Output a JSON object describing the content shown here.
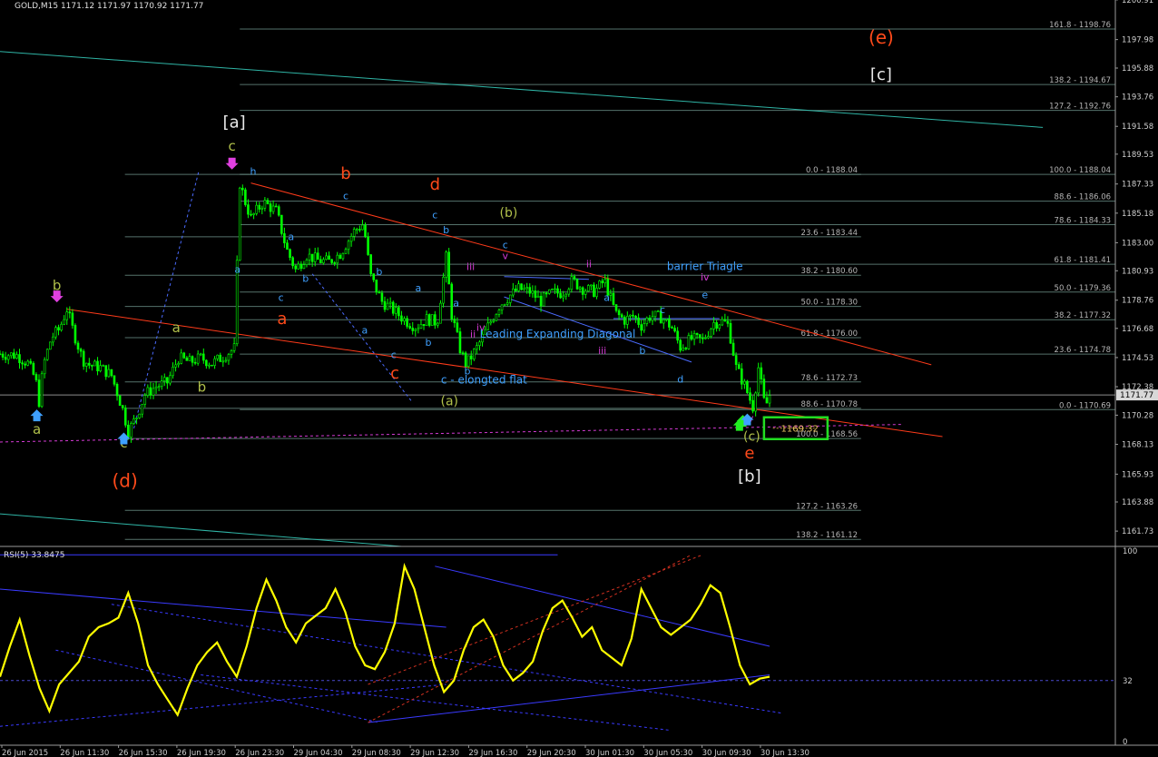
{
  "symbol_header": "GOLD,M15  1171.12 1171.97 1170.92 1171.77",
  "rsi_header": "RSI(5) 33.8475",
  "current_price_tag": "1171.77",
  "target_box_text": "1169.32",
  "colors": {
    "background": "#000000",
    "candle": "#00ff00",
    "level_line": "#6b8f86",
    "fib_text": "#b5b5b5",
    "trend_red": "#ff3b1a",
    "channel_teal": "#2fb4a5",
    "rsi_line": "#ffff00",
    "rsi_guides": "#3a3aff",
    "dotted_magenta": "#d43ad4",
    "target_box": "#22dd22"
  },
  "chart_data": {
    "type": "candlestick",
    "price_axis": {
      "range": [
        1160.6,
        1200.9
      ],
      "ticks": [
        "1200.91",
        "1197.98",
        "1195.88",
        "1193.76",
        "1191.58",
        "1189.53",
        "1187.33",
        "1185.18",
        "1183.00",
        "1180.93",
        "1178.76",
        "1176.68",
        "1174.53",
        "1172.38",
        "1170.28",
        "1168.13",
        "1165.93",
        "1163.88",
        "1161.73"
      ]
    },
    "time_axis": {
      "range": [
        0,
        100
      ],
      "labels": [
        "26 Jun 2015",
        "26 Jun 11:30",
        "26 Jun 15:30",
        "26 Jun 19:30",
        "26 Jun 23:30",
        "29 Jun 04:30",
        "29 Jun 08:30",
        "29 Jun 12:30",
        "29 Jun 16:30",
        "29 Jun 20:30",
        "30 Jun 01:30",
        "30 Jun 05:30",
        "30 Jun 09:30",
        "30 Jun 13:30"
      ]
    },
    "price_path": [
      [
        0.0,
        1174.8
      ],
      [
        1.5,
        1174.7
      ],
      [
        2.5,
        1174.1
      ],
      [
        3.2,
        1172.9
      ],
      [
        3.5,
        1171.3
      ],
      [
        3.9,
        1174.0
      ],
      [
        4.6,
        1176.0
      ],
      [
        5.3,
        1176.6
      ],
      [
        6.0,
        1178.1
      ],
      [
        6.6,
        1176.4
      ],
      [
        7.4,
        1174.4
      ],
      [
        8.0,
        1174.0
      ],
      [
        9.0,
        1173.8
      ],
      [
        10.0,
        1173.2
      ],
      [
        11.0,
        1170.7
      ],
      [
        11.5,
        1169.1
      ],
      [
        12.2,
        1170.1
      ],
      [
        13.0,
        1171.8
      ],
      [
        14.0,
        1172.4
      ],
      [
        15.0,
        1172.7
      ],
      [
        16.0,
        1174.5
      ],
      [
        17.0,
        1174.2
      ],
      [
        18.0,
        1174.5
      ],
      [
        19.0,
        1174.1
      ],
      [
        20.0,
        1174.6
      ],
      [
        21.0,
        1175.2
      ],
      [
        21.5,
        1187.4
      ],
      [
        22.0,
        1186.0
      ],
      [
        22.5,
        1184.8
      ],
      [
        23.6,
        1186.0
      ],
      [
        24.8,
        1185.3
      ],
      [
        25.7,
        1182.5
      ],
      [
        26.5,
        1181.0
      ],
      [
        27.5,
        1182.1
      ],
      [
        28.5,
        1181.7
      ],
      [
        29.5,
        1181.6
      ],
      [
        30.5,
        1182.2
      ],
      [
        31.8,
        1183.9
      ],
      [
        32.6,
        1184.4
      ],
      [
        33.2,
        1180.6
      ],
      [
        34.2,
        1178.7
      ],
      [
        35.3,
        1178.0
      ],
      [
        36.3,
        1177.3
      ],
      [
        37.3,
        1176.8
      ],
      [
        38.3,
        1177.4
      ],
      [
        39.2,
        1177.1
      ],
      [
        40.0,
        1181.9
      ],
      [
        40.5,
        1177.7
      ],
      [
        41.3,
        1175.0
      ],
      [
        41.8,
        1174.0
      ],
      [
        42.8,
        1175.3
      ],
      [
        43.8,
        1176.9
      ],
      [
        44.8,
        1178.4
      ],
      [
        45.7,
        1179.1
      ],
      [
        46.5,
        1179.6
      ],
      [
        47.5,
        1179.4
      ],
      [
        48.5,
        1178.7
      ],
      [
        49.5,
        1179.3
      ],
      [
        50.4,
        1179.3
      ],
      [
        51.3,
        1180.2
      ],
      [
        52.3,
        1179.6
      ],
      [
        53.3,
        1179.4
      ],
      [
        54.2,
        1180.2
      ],
      [
        55.2,
        1177.8
      ],
      [
        56.0,
        1177.3
      ],
      [
        56.8,
        1177.6
      ],
      [
        57.5,
        1176.9
      ],
      [
        58.3,
        1177.6
      ],
      [
        59.3,
        1177.5
      ],
      [
        60.2,
        1176.8
      ],
      [
        61.0,
        1175.3
      ],
      [
        62.0,
        1175.9
      ],
      [
        63.0,
        1175.8
      ],
      [
        64.0,
        1177.1
      ],
      [
        64.8,
        1177.2
      ],
      [
        65.3,
        1176.9
      ],
      [
        66.0,
        1173.8
      ],
      [
        66.8,
        1172.4
      ],
      [
        67.5,
        1170.9
      ],
      [
        68.0,
        1173.8
      ],
      [
        68.6,
        1170.8
      ],
      [
        69.0,
        1171.77
      ]
    ],
    "fib_levels_left": [
      {
        "label": "0.0 - 1188.04",
        "price": 1188.04
      },
      {
        "label": "23.6 - 1183.44",
        "price": 1183.44
      },
      {
        "label": "38.2 - 1180.60",
        "price": 1180.6
      },
      {
        "label": "50.0 - 1178.30",
        "price": 1178.3
      },
      {
        "label": "61.8 - 1176.00",
        "price": 1176.0
      },
      {
        "label": "78.6 - 1172.73",
        "price": 1172.73
      },
      {
        "label": "88.6 - 1170.78",
        "price": 1170.78
      },
      {
        "label": "100.0 - 1168.56",
        "price": 1168.56
      },
      {
        "label": "127.2 - 1163.26",
        "price": 1163.26
      },
      {
        "label": "138.2 - 1161.12",
        "price": 1161.12
      }
    ],
    "fib_levels_right": [
      {
        "label": "161.8 - 1198.76",
        "price": 1198.76
      },
      {
        "label": "138.2 - 1194.67",
        "price": 1194.67
      },
      {
        "label": "127.2 - 1192.76",
        "price": 1192.76
      },
      {
        "label": "100.0 - 1188.04",
        "price": 1188.04
      },
      {
        "label": "88.6 - 1186.06",
        "price": 1186.06
      },
      {
        "label": "78.6 - 1184.33",
        "price": 1184.33
      },
      {
        "label": "61.8 - 1181.41",
        "price": 1181.41
      },
      {
        "label": "50.0 - 1179.36",
        "price": 1179.36
      },
      {
        "label": "38.2 - 1177.32",
        "price": 1177.32
      },
      {
        "label": "23.6 - 1174.78",
        "price": 1174.78
      },
      {
        "label": "0.0 - 1170.69",
        "price": 1170.69
      }
    ],
    "trend_lines": [
      {
        "name": "upper-red",
        "color": "#ff3b1a",
        "from": [
          22.5,
          1187.4
        ],
        "to": [
          83.5,
          1174.0
        ]
      },
      {
        "name": "lower-red",
        "color": "#ff3b1a",
        "from": [
          6.0,
          1178.1
        ],
        "to": [
          84.5,
          1168.7
        ]
      },
      {
        "name": "teal-upper",
        "color": "#2fb4a5",
        "from": [
          0.0,
          1197.1
        ],
        "to": [
          93.5,
          1191.5
        ]
      },
      {
        "name": "teal-lower",
        "color": "#2fb4a5",
        "from": [
          0.0,
          1163.0
        ],
        "to": [
          36.0,
          1160.6
        ]
      },
      {
        "name": "magenta-dotted",
        "color": "#d43ad4",
        "from": [
          0.0,
          1168.3
        ],
        "to": [
          81.0,
          1169.6
        ],
        "dashed": true
      },
      {
        "name": "diag-upper",
        "color": "#4b6bff",
        "from": [
          45.2,
          1180.5
        ],
        "to": [
          52.8,
          1180.3
        ]
      },
      {
        "name": "diag-lower",
        "color": "#4b6bff",
        "from": [
          45.2,
          1179.0
        ],
        "to": [
          62.0,
          1174.2
        ]
      },
      {
        "name": "triangle-a",
        "color": "#4b6bff",
        "from": [
          55.0,
          1177.4
        ],
        "to": [
          64.5,
          1177.4
        ]
      },
      {
        "name": "blue-dotted-1",
        "color": "#4b6bff",
        "from": [
          12.0,
          1169.3
        ],
        "to": [
          17.8,
          1188.2
        ],
        "dashed": true
      },
      {
        "name": "blue-dotted-2",
        "color": "#4b6bff",
        "from": [
          28.0,
          1180.7
        ],
        "to": [
          37.0,
          1171.2
        ],
        "dashed": true
      }
    ],
    "wave_labels": [
      {
        "text": "[a]",
        "x": 21.0,
        "price": 1191.5,
        "color": "#e8e8e8",
        "size": 18
      },
      {
        "text": "[b]",
        "x": 67.2,
        "price": 1165.4,
        "color": "#e8e8e8",
        "size": 18
      },
      {
        "text": "[c]",
        "x": 79.0,
        "price": 1195.0,
        "color": "#e8e8e8",
        "size": 18
      },
      {
        "text": "(d)",
        "x": 11.2,
        "price": 1165.0,
        "color": "#ff4a1a",
        "size": 20
      },
      {
        "text": "(e)",
        "x": 79.0,
        "price": 1197.7,
        "color": "#ff4a1a",
        "size": 20
      },
      {
        "text": "b",
        "x": 31.0,
        "price": 1187.7,
        "color": "#ff4a1a",
        "size": 18
      },
      {
        "text": "d",
        "x": 39.0,
        "price": 1186.9,
        "color": "#ff4a1a",
        "size": 18
      },
      {
        "text": "a",
        "x": 25.3,
        "price": 1177.0,
        "color": "#ff4a1a",
        "size": 18
      },
      {
        "text": "c",
        "x": 35.4,
        "price": 1173.0,
        "color": "#ff4a1a",
        "size": 18
      },
      {
        "text": "e",
        "x": 67.2,
        "price": 1167.1,
        "color": "#ff4a1a",
        "size": 18
      },
      {
        "text": "(b)",
        "x": 45.6,
        "price": 1184.9,
        "color": "#b0c04a",
        "size": 14
      },
      {
        "text": "(a)",
        "x": 40.3,
        "price": 1171.0,
        "color": "#b0c04a",
        "size": 14
      },
      {
        "text": "(c)",
        "x": 67.4,
        "price": 1168.4,
        "color": "#b0c04a",
        "size": 14
      },
      {
        "text": "c",
        "x": 20.8,
        "price": 1189.8,
        "color": "#b0c04a",
        "size": 15
      },
      {
        "text": "b",
        "x": 5.1,
        "price": 1179.5,
        "color": "#b0c04a",
        "size": 15
      },
      {
        "text": "a",
        "x": 15.8,
        "price": 1176.4,
        "color": "#b0c04a",
        "size": 15
      },
      {
        "text": "b",
        "x": 18.1,
        "price": 1172.0,
        "color": "#b0c04a",
        "size": 15
      },
      {
        "text": "a",
        "x": 3.3,
        "price": 1168.9,
        "color": "#b0c04a",
        "size": 15
      },
      {
        "text": "c",
        "x": 11.1,
        "price": 1167.9,
        "color": "#b0c04a",
        "size": 15
      },
      {
        "text": "h",
        "x": 22.7,
        "price": 1188.0,
        "color": "#3fa0ff",
        "size": 11
      },
      {
        "text": "c",
        "x": 31.0,
        "price": 1186.2,
        "color": "#3fa0ff",
        "size": 11
      },
      {
        "text": "c",
        "x": 39.0,
        "price": 1184.8,
        "color": "#3fa0ff",
        "size": 11
      },
      {
        "text": "b",
        "x": 40.0,
        "price": 1183.7,
        "color": "#3fa0ff",
        "size": 11
      },
      {
        "text": "a",
        "x": 26.1,
        "price": 1183.2,
        "color": "#3fa0ff",
        "size": 11
      },
      {
        "text": "a",
        "x": 21.3,
        "price": 1180.8,
        "color": "#3fa0ff",
        "size": 11
      },
      {
        "text": "b",
        "x": 27.4,
        "price": 1180.1,
        "color": "#3fa0ff",
        "size": 11
      },
      {
        "text": "c",
        "x": 25.2,
        "price": 1178.7,
        "color": "#3fa0ff",
        "size": 11
      },
      {
        "text": "b",
        "x": 34.0,
        "price": 1180.6,
        "color": "#3fa0ff",
        "size": 11
      },
      {
        "text": "a",
        "x": 37.5,
        "price": 1179.4,
        "color": "#3fa0ff",
        "size": 11
      },
      {
        "text": "a",
        "x": 32.7,
        "price": 1176.3,
        "color": "#3fa0ff",
        "size": 11
      },
      {
        "text": "c",
        "x": 35.3,
        "price": 1174.5,
        "color": "#3fa0ff",
        "size": 11
      },
      {
        "text": "b",
        "x": 38.4,
        "price": 1175.4,
        "color": "#3fa0ff",
        "size": 11
      },
      {
        "text": "a",
        "x": 40.9,
        "price": 1178.3,
        "color": "#3fa0ff",
        "size": 11
      },
      {
        "text": "b",
        "x": 41.9,
        "price": 1173.3,
        "color": "#3fa0ff",
        "size": 11
      },
      {
        "text": "c",
        "x": 45.3,
        "price": 1182.6,
        "color": "#3fa0ff",
        "size": 11
      },
      {
        "text": "a",
        "x": 54.4,
        "price": 1178.7,
        "color": "#3fa0ff",
        "size": 11
      },
      {
        "text": "c",
        "x": 59.4,
        "price": 1177.8,
        "color": "#3fa0ff",
        "size": 11
      },
      {
        "text": "b",
        "x": 57.6,
        "price": 1174.8,
        "color": "#3fa0ff",
        "size": 11
      },
      {
        "text": "d",
        "x": 61.0,
        "price": 1172.7,
        "color": "#3fa0ff",
        "size": 11
      },
      {
        "text": "e",
        "x": 63.2,
        "price": 1178.9,
        "color": "#3fa0ff",
        "size": 11
      },
      {
        "text": "iii",
        "x": 42.2,
        "price": 1181.0,
        "color": "#d43ad4",
        "size": 11
      },
      {
        "text": "iv",
        "x": 43.1,
        "price": 1176.5,
        "color": "#d43ad4",
        "size": 11
      },
      {
        "text": "ii",
        "x": 42.4,
        "price": 1176.0,
        "color": "#d43ad4",
        "size": 11
      },
      {
        "text": "v",
        "x": 45.3,
        "price": 1181.8,
        "color": "#d43ad4",
        "size": 11
      },
      {
        "text": "ii",
        "x": 52.8,
        "price": 1181.2,
        "color": "#d43ad4",
        "size": 11
      },
      {
        "text": "iii",
        "x": 54.0,
        "price": 1174.8,
        "color": "#d43ad4",
        "size": 11
      },
      {
        "text": "iv",
        "x": 63.2,
        "price": 1180.2,
        "color": "#d43ad4",
        "size": 11
      },
      {
        "text": "v",
        "x": 67.3,
        "price": 1169.8,
        "color": "#d43ad4",
        "size": 11
      },
      {
        "text": "barrier Triagle",
        "x": 63.2,
        "price": 1181.0,
        "color": "#3fa0ff",
        "size": 12
      },
      {
        "text": "Leading Expanding Diagonal",
        "x": 50.0,
        "price": 1176.0,
        "color": "#3fa0ff",
        "size": 12
      },
      {
        "text": "c - elongted flat",
        "x": 43.4,
        "price": 1172.6,
        "color": "#3fa0ff",
        "size": 12
      }
    ],
    "arrows": [
      {
        "dir": "down",
        "x": 20.8,
        "price": 1188.6,
        "color": "#e040e0"
      },
      {
        "dir": "down",
        "x": 5.1,
        "price": 1178.8,
        "color": "#e040e0"
      },
      {
        "dir": "up",
        "x": 3.3,
        "price": 1170.5,
        "color": "#3fa0ff"
      },
      {
        "dir": "up",
        "x": 11.1,
        "price": 1168.8,
        "color": "#3fa0ff"
      },
      {
        "dir": "up",
        "x": 66.3,
        "price": 1169.8,
        "color": "#22ee22"
      },
      {
        "dir": "up",
        "x": 66.6,
        "price": 1170.1,
        "color": "#22ee22"
      },
      {
        "dir": "up",
        "x": 67.0,
        "price": 1170.2,
        "color": "#3fa0ff"
      }
    ],
    "rsi": {
      "range": [
        0,
        100
      ],
      "ticks": [
        "100",
        "32",
        "0"
      ],
      "values": [
        34,
        50,
        64,
        45,
        28,
        16,
        30,
        36,
        42,
        55,
        60,
        62,
        65,
        78,
        62,
        40,
        30,
        22,
        14,
        28,
        40,
        47,
        52,
        42,
        34,
        50,
        70,
        85,
        74,
        60,
        52,
        62,
        66,
        70,
        80,
        68,
        50,
        40,
        38,
        47,
        62,
        92,
        80,
        60,
        40,
        26,
        32,
        48,
        60,
        64,
        55,
        40,
        32,
        36,
        42,
        58,
        70,
        74,
        65,
        55,
        60,
        48,
        44,
        40,
        54,
        80,
        70,
        60,
        56,
        60,
        64,
        72,
        82,
        78,
        60,
        40,
        30,
        33,
        34
      ],
      "guide_lines": [
        {
          "from": [
            0,
            98
          ],
          "to": [
            50,
            98
          ]
        },
        {
          "from": [
            0,
            80
          ],
          "to": [
            40,
            60
          ]
        },
        {
          "from": [
            33,
            10
          ],
          "to": [
            69,
            35
          ]
        },
        {
          "from": [
            39,
            92
          ],
          "to": [
            69,
            50
          ]
        },
        {
          "from": [
            5,
            48
          ],
          "to": [
            34,
            10
          ],
          "dashed": true
        },
        {
          "from": [
            0,
            8
          ],
          "to": [
            40,
            30
          ],
          "dashed": true
        },
        {
          "from": [
            10,
            72
          ],
          "to": [
            70,
            15
          ],
          "dashed": true
        },
        {
          "from": [
            18,
            35
          ],
          "to": [
            60,
            6
          ],
          "dashed": true
        }
      ],
      "dotted_red": [
        {
          "from": [
            33,
            10
          ],
          "to": [
            62,
            98
          ]
        },
        {
          "from": [
            33,
            30
          ],
          "to": [
            63,
            98
          ]
        }
      ]
    }
  }
}
